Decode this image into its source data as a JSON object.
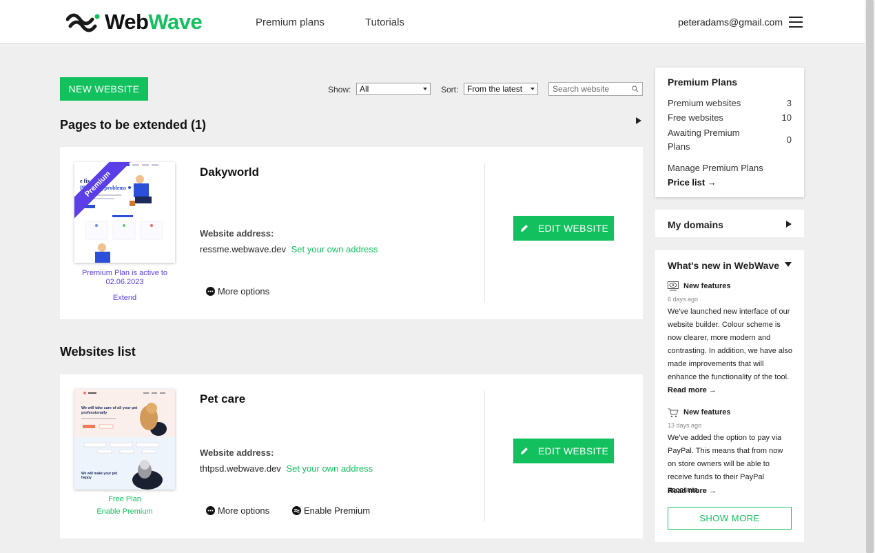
{
  "header": {
    "logo": {
      "part1": "Web",
      "part2": "Wave"
    },
    "nav": [
      "Premium plans",
      "Tutorials"
    ],
    "user_email": "peteradams@gmail.com"
  },
  "toolbar": {
    "new_website_label": "NEW WEBSITE",
    "show_label": "Show:",
    "show_value": "All",
    "sort_label": "Sort:",
    "sort_value": "From the latest",
    "search_placeholder": "Search website"
  },
  "pages_to_extend": {
    "title": "Pages to be extended (1)",
    "site": {
      "name": "Dakyworld",
      "ribbon": "Premium",
      "plan_status": "Premium Plan is active to 02.06.2023",
      "plan_action": "Extend",
      "address_label": "Website address:",
      "address": "ressme.webwave.dev",
      "own_address_link": "Set your own address",
      "more_options": "More options",
      "edit_label": "EDIT WEBSITE",
      "thumb_text": "e fix all your Plumbing problems"
    }
  },
  "websites_list": {
    "title": "Websites list",
    "site": {
      "name": "Pet care",
      "plan_status": "Free Plan",
      "plan_action": "Enable Premium",
      "address_label": "Website address:",
      "address": "thtpsd.webwave.dev",
      "own_address_link": "Set your own address",
      "more_options": "More options",
      "enable_premium": "Enable Premium",
      "edit_label": "EDIT WEBSITE",
      "thumb_text": "We will take care of all your pet professionally",
      "thumb_text2": "We will make your pet happy"
    }
  },
  "sidebar": {
    "premium_plans": {
      "title": "Premium Plans",
      "rows": [
        {
          "label": "Premium websites",
          "value": "3"
        },
        {
          "label": "Free websites",
          "value": "10"
        },
        {
          "label": "Awaiting Premium Plans",
          "value": "0"
        }
      ],
      "manage_label": "Manage Premium Plans",
      "price_list_label": "Price list →"
    },
    "my_domains": "My domains",
    "whats_new": {
      "title": "What's new in WebWave",
      "items": [
        {
          "title": "New features",
          "date": "6 days ago",
          "body": "We've launched new interface of our website builder. Colour scheme is now clearer, more modern and contrasting. In addition, we have also made improvements that will enhance the functionality of the tool.",
          "read_more": "Read more →"
        },
        {
          "title": "New features",
          "date": "13 days ago",
          "body": "We've added the option to pay via PayPal. This means that from now on store owners will be able to receive funds to their PayPal accounts.",
          "read_more": "Read more →"
        }
      ],
      "show_more": "SHOW MORE"
    }
  },
  "colors": {
    "accent": "#12c15e",
    "premium": "#5b3ee6",
    "plan_text": "#5b3ee6"
  }
}
